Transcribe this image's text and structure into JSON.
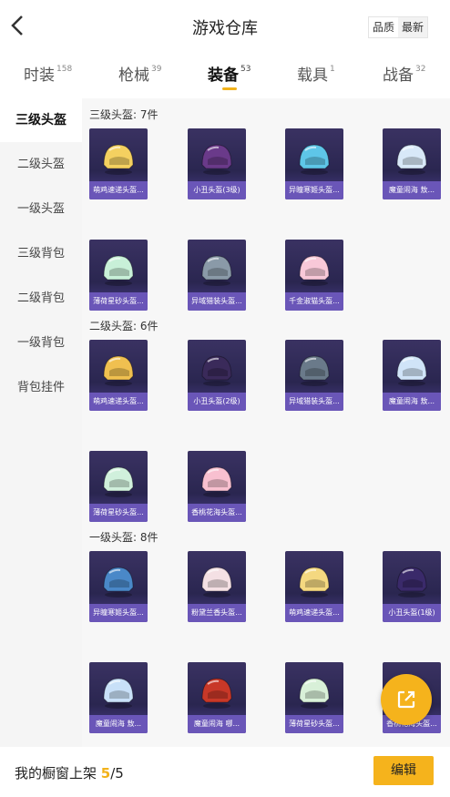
{
  "header": {
    "title": "游戏仓库",
    "sort_options": [
      "品质",
      "最新"
    ]
  },
  "tabs": [
    {
      "label": "时装",
      "count": "158"
    },
    {
      "label": "枪械",
      "count": "39"
    },
    {
      "label": "装备",
      "count": "53"
    },
    {
      "label": "载具",
      "count": "1"
    },
    {
      "label": "战备",
      "count": "32"
    }
  ],
  "sidebar": [
    "三级头盔",
    "二级头盔",
    "一级头盔",
    "三级背包",
    "二级背包",
    "一级背包",
    "背包挂件"
  ],
  "sections": [
    {
      "title": "三级头盔: 7件",
      "items": [
        {
          "label": "萌鸡速递头盔...",
          "color": "#f4d060"
        },
        {
          "label": "小丑头盔(3级)",
          "color": "#6a3a8a"
        },
        {
          "label": "异瞳寒姬头盔...",
          "color": "#5ec6e8"
        },
        {
          "label": "魔童闹海 敖...",
          "color": "#d8e8f8"
        },
        {
          "label": "薄荷星砂头盔...",
          "color": "#c8f0d8"
        },
        {
          "label": "异域猎装头盔...",
          "color": "#8a9aa8"
        },
        {
          "label": "千金淑猫头盔...",
          "color": "#f8c8d8"
        }
      ]
    },
    {
      "title": "二级头盔: 6件",
      "items": [
        {
          "label": "萌鸡速递头盔...",
          "color": "#f0c050"
        },
        {
          "label": "小丑头盔(2级)",
          "color": "#3a2a5a"
        },
        {
          "label": "异域猎装头盔...",
          "color": "#6a7a8a"
        },
        {
          "label": "魔童闹海 敖...",
          "color": "#d0e4f8"
        },
        {
          "label": "薄荷星砂头盔...",
          "color": "#d0f0dc"
        },
        {
          "label": "香桃花海头盔...",
          "color": "#f8c0d0"
        }
      ]
    },
    {
      "title": "一级头盔: 8件",
      "items": [
        {
          "label": "异瞳寒姬头盔...",
          "color": "#4a88c8"
        },
        {
          "label": "粉黛兰香头盔...",
          "color": "#f4e0e4"
        },
        {
          "label": "萌鸡速递头盔...",
          "color": "#f4d880"
        },
        {
          "label": "小丑头盔(1级)",
          "color": "#3a2a6a"
        },
        {
          "label": "魔童闹海 敖...",
          "color": "#c8e0f8"
        },
        {
          "label": "魔童闹海 哪...",
          "color": "#c83828"
        },
        {
          "label": "薄荷星砂头盔...",
          "color": "#d8f0d8"
        },
        {
          "label": "香桃花海头盔...",
          "color": "#f4e8d0"
        }
      ]
    }
  ],
  "footer": {
    "text": "我的橱窗上架",
    "current": "5",
    "total": "/5",
    "edit_label": "编辑"
  }
}
